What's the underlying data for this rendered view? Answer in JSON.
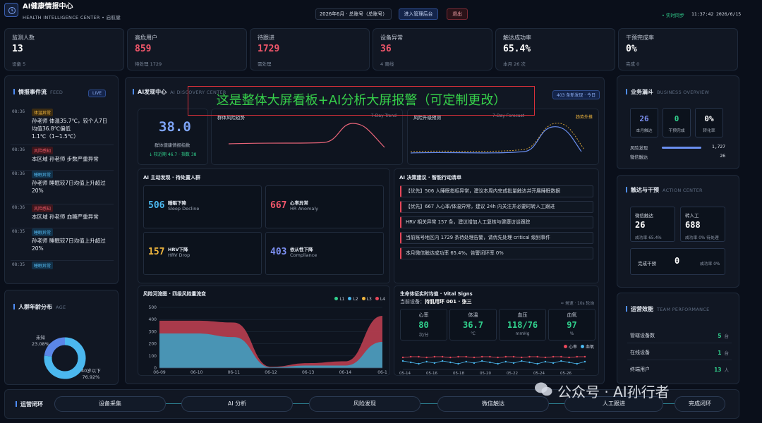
{
  "header": {
    "title": "AI健康情报中心",
    "subtitle": "HEALTH INTELLIGENCE CENTER • 启航健",
    "period_select": "2026年6月 · 总账号（总账号）",
    "admin_button": "进入管理后台",
    "logout_button": "退出",
    "sync_status": "• 实时同步",
    "time": "11:37:42",
    "date": "2026/6/15"
  },
  "kpis": [
    {
      "label": "监测人数",
      "value": "13",
      "sub": "设备 5",
      "color": "#ffffff"
    },
    {
      "label": "高危用户",
      "value": "859",
      "sub": "待处理 1729",
      "color": "#f0566a"
    },
    {
      "label": "待跟进",
      "value": "1729",
      "sub": "需处理",
      "color": "#f0566a"
    },
    {
      "label": "设备异常",
      "value": "36",
      "sub": "4 离线",
      "color": "#f0566a"
    },
    {
      "label": "触达成功率",
      "value": "65.4%",
      "sub": "本月 26 次",
      "color": "#ffffff"
    },
    {
      "label": "干预完成率",
      "value": "0%",
      "sub": "完成 0",
      "color": "#ffffff"
    }
  ],
  "feed": {
    "title": "情报事件流",
    "sub": "FEED",
    "live": "LIVE",
    "items": [
      {
        "time": "08:36",
        "tag": "体温异常",
        "tag_type": "warn",
        "text": "孙老师 体温35.7℃，较个人7日均值36.8℃偏低1.1℃（1~1.5℃）"
      },
      {
        "time": "08:36",
        "tag": "风险感知",
        "tag_type": "red",
        "text": "本区域 孙老师 步数严重异常"
      },
      {
        "time": "08:36",
        "tag": "睡眠异常",
        "tag_type": "blue",
        "text": "孙老师 睡眠较7日均值上升超过20%"
      },
      {
        "time": "08:36",
        "tag": "风险感知",
        "tag_type": "red",
        "text": "本区域 孙老师 血糖严重异常"
      },
      {
        "time": "08:35",
        "tag": "睡眠异常",
        "tag_type": "blue",
        "text": "孙老师 睡眠较7日均值上升超过20%"
      },
      {
        "time": "08:35",
        "tag": "睡眠异常",
        "tag_type": "blue",
        "text": ""
      }
    ]
  },
  "age": {
    "title": "人群年龄分布",
    "sub": "AGE",
    "slices": [
      {
        "label": "未知",
        "pct": "23.08%",
        "value": 23.08,
        "color": "#5b87e8"
      },
      {
        "label": "40岁以下",
        "pct": "76.92%",
        "value": 76.92,
        "color": "#4bb8ef"
      }
    ]
  },
  "discovery": {
    "title": "AI发现中心",
    "sub": "AI DISCOVERY CENTER",
    "badge": "403 条新发现 · 今日",
    "index_value": "38.0",
    "index_label": "群体健康情报指数",
    "index_change": "↓ 较近期 46.7 · 指数 38",
    "trend_title": "群体风险趋势",
    "trend_sub": "7-Day Trend",
    "forecast_title": "风险升级预测",
    "forecast_sub": "7-Day Forecast",
    "forecast_badge": "趋势外推",
    "overlay_text": "这是整体大屏看板+AI分析大屏报警（可定制更改）"
  },
  "active": {
    "title": "AI 主动发现 · 待处置人群",
    "items": [
      {
        "num": "506",
        "t": "睡眠下降",
        "e": "Sleep Decline",
        "color": "#4bb8ef"
      },
      {
        "num": "667",
        "t": "心率异常",
        "e": "HR Anomaly",
        "color": "#f0566a"
      },
      {
        "num": "157",
        "t": "HRV下降",
        "e": "HRV Drop",
        "color": "#f0b63e"
      },
      {
        "num": "403",
        "t": "依从性下降",
        "e": "Compliance",
        "color": "#7c8ff0"
      }
    ]
  },
  "suggestions": {
    "title": "AI 决策建议 · 智能行动清单",
    "items": [
      "【优先】506 人睡眠指标异常，建议本周内完成批量触达并开展睡眠数据",
      "【优先】667 人心率/体温异常，建议 24h 内关注并必要时转人工跟进",
      "HRV 相关异常 157 条，建议增加人工复核与健康访谈跟踪",
      "当前账号地区内 1729 条待处理告警，请优先处理 critical 级别事件",
      "本月微信触达成功率 65.4%，告警闭环率 0%"
    ]
  },
  "risk_chart": {
    "title": "风险河流图 · 四级风险量流变",
    "legend": [
      "L1",
      "L2",
      "L3",
      "L4"
    ],
    "colors": [
      "#31d18d",
      "#4bb8ef",
      "#f0b63e",
      "#e8475a"
    ]
  },
  "chart_data": {
    "type": "area",
    "x": [
      "06-09",
      "06-10",
      "06-11",
      "06-12",
      "06-13",
      "06-14",
      "06-1"
    ],
    "ylim": [
      0,
      500
    ],
    "yticks": [
      0,
      100,
      200,
      300,
      400,
      500
    ],
    "series": [
      {
        "name": "L2",
        "values": [
          285,
          285,
          255,
          5,
          20,
          20,
          215
        ]
      },
      {
        "name": "L4",
        "values": [
          390,
          390,
          375,
          10,
          40,
          55,
          430
        ]
      }
    ]
  },
  "vitals": {
    "title": "生命体征实时均值 · Vital Signs",
    "device": "当前设备：",
    "device_name": "持肌用环 001 · 张三",
    "mode": "≈ 常速 · 10s 轮询",
    "cards": [
      {
        "label": "心率",
        "value": "80",
        "unit": "次/分"
      },
      {
        "label": "体温",
        "value": "36.7",
        "unit": "℃"
      },
      {
        "label": "血压",
        "value": "118/76",
        "unit": "mmHg"
      },
      {
        "label": "血氧",
        "value": "97",
        "unit": "%"
      }
    ],
    "legend": [
      "心率",
      "血氧"
    ],
    "x": [
      "05-14",
      "05-16",
      "05-18",
      "05-20",
      "05-22",
      "05-24",
      "05-26"
    ]
  },
  "business": {
    "title": "业务漏斗",
    "sub": "BUSINESS OVERVIEW",
    "boxes": [
      {
        "value": "26",
        "label": "本月触达",
        "color": "#7c8ff0"
      },
      {
        "value": "0",
        "label": "干预完成",
        "color": "#31d18d"
      },
      {
        "value": "0%",
        "label": "转化率",
        "color": "#ffffff"
      }
    ],
    "rows": [
      {
        "label": "风险发现",
        "value": "1,727"
      },
      {
        "label": "微信触达",
        "value": "26"
      }
    ]
  },
  "action": {
    "title": "触达与干预",
    "sub": "ACTION CENTER",
    "boxes": [
      {
        "label": "微信触达",
        "value": "26",
        "sub": "成功率 65.4%"
      },
      {
        "label": "转人工",
        "value": "688",
        "sub": "成功率 0% 待处理"
      }
    ],
    "done_label": "完成干预",
    "done_value": "0",
    "done_sub": "成功率 0%"
  },
  "team": {
    "title": "运营效能",
    "sub": "TEAM PERFORMANCE",
    "rows": [
      {
        "label": "管辖设备数",
        "value": "5",
        "unit": "台"
      },
      {
        "label": "在线设备",
        "value": "1",
        "unit": "台"
      },
      {
        "label": "终端用户",
        "value": "13",
        "unit": "人"
      }
    ]
  },
  "loop": {
    "title": "运营闭环",
    "steps": [
      "设备采集",
      "AI 分析",
      "风险发现",
      "微信触达",
      "人工跟进",
      "完成闭环"
    ]
  },
  "watermark": "公众号 · AI孙行者"
}
